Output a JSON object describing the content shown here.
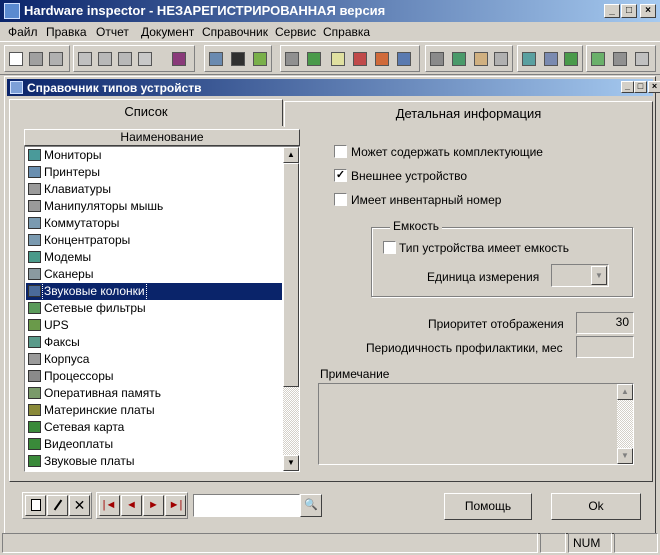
{
  "window": {
    "title": "Hardware inspector - НЕЗАРЕГИСТРИРОВАННАЯ версия",
    "buttons": {
      "minimize": "_",
      "maximize": "□",
      "close": "×"
    }
  },
  "menu": [
    "Файл",
    "Правка",
    "Отчет",
    "Документ",
    "Справочник",
    "Сервис",
    "Справка"
  ],
  "toolbar": {
    "icons": [
      "new-doc",
      "save",
      "delete",
      "cut",
      "copy",
      "paste",
      "undo",
      "book",
      "users",
      "find",
      "export",
      "print",
      "report",
      "doc",
      "report-2",
      "chart",
      "rent",
      "computer",
      "cart",
      "hand",
      "transfer",
      "repair",
      "modules",
      "shield",
      "printer",
      "tools"
    ]
  },
  "child_window": {
    "title": "Справочник типов устройств",
    "buttons": {
      "minimize": "_",
      "maximize": "□",
      "close": "×"
    }
  },
  "tabs": [
    {
      "label": "Список",
      "active": true
    },
    {
      "label": "Детальная информация",
      "active": false
    }
  ],
  "list": {
    "header": "Наименование",
    "items": [
      {
        "label": "Мониторы",
        "icon": "monitor-icon",
        "color": "#4a9a9a"
      },
      {
        "label": "Принтеры",
        "icon": "printer-icon",
        "color": "#6a8fb0"
      },
      {
        "label": "Клавиатуры",
        "icon": "keyboard-icon",
        "color": "#9a9a9a"
      },
      {
        "label": "Манипуляторы мышь",
        "icon": "mouse-icon",
        "color": "#9a9a9a"
      },
      {
        "label": "Коммутаторы",
        "icon": "switch-icon",
        "color": "#7a9ab0"
      },
      {
        "label": "Концентраторы",
        "icon": "hub-icon",
        "color": "#7a9ab0"
      },
      {
        "label": "Модемы",
        "icon": "modem-icon",
        "color": "#4a9a8a"
      },
      {
        "label": "Сканеры",
        "icon": "scanner-icon",
        "color": "#8a9aa0"
      },
      {
        "label": "Звуковые колонки",
        "icon": "speakers-icon",
        "color": "#4a6a9a"
      },
      {
        "label": "Сетевые фильтры",
        "icon": "surge-filter-icon",
        "color": "#5a9a5a"
      },
      {
        "label": "UPS",
        "icon": "ups-icon",
        "color": "#6a9a4a"
      },
      {
        "label": "Факсы",
        "icon": "fax-icon",
        "color": "#5a9a8a"
      },
      {
        "label": "Корпуса",
        "icon": "case-icon",
        "color": "#9a9a9a"
      },
      {
        "label": "Процессоры",
        "icon": "cpu-icon",
        "color": "#8a8a8a"
      },
      {
        "label": "Оперативная память",
        "icon": "ram-icon",
        "color": "#7a9a6a"
      },
      {
        "label": "Материнские платы",
        "icon": "motherboard-icon",
        "color": "#8a8a3a"
      },
      {
        "label": "Сетевая карта",
        "icon": "network-card-icon",
        "color": "#3a8a3a"
      },
      {
        "label": "Видеоплаты",
        "icon": "video-card-icon",
        "color": "#3a8a3a"
      },
      {
        "label": "Звуковые платы",
        "icon": "sound-card-icon",
        "color": "#3a8a3a"
      }
    ],
    "selected": "Звуковые колонки",
    "scroll_up": "▲",
    "scroll_down": "▼"
  },
  "details": {
    "checks": [
      {
        "label": "Может содержать комплектующие",
        "checked": false
      },
      {
        "label": "Внешнее устройство",
        "checked": true
      },
      {
        "label": "Имеет инвентарный номер",
        "checked": false
      }
    ],
    "capacity_group": {
      "caption": "Емкость",
      "has_capacity_label": "Тип устройства имеет емкость",
      "has_capacity_checked": false,
      "unit_label": "Единица измерения",
      "unit_value": "",
      "dropdown_arrow": "▼"
    },
    "priority_label": "Приоритет отображения",
    "priority_value": "30",
    "maintenance_label": "Периодичность профилактики, мес",
    "maintenance_value": "",
    "note_label": "Примечание",
    "note_value": "",
    "note_scroll_up": "▲",
    "note_scroll_down": "▼"
  },
  "nav": {
    "first": "|◄",
    "prev": "◄",
    "next": "►",
    "last": "►|",
    "search_value": "",
    "search_icon": "🔍"
  },
  "buttons": {
    "help": "Помощь",
    "ok": "Ok"
  },
  "status": {
    "num": "NUM"
  },
  "check_mark": "✓"
}
